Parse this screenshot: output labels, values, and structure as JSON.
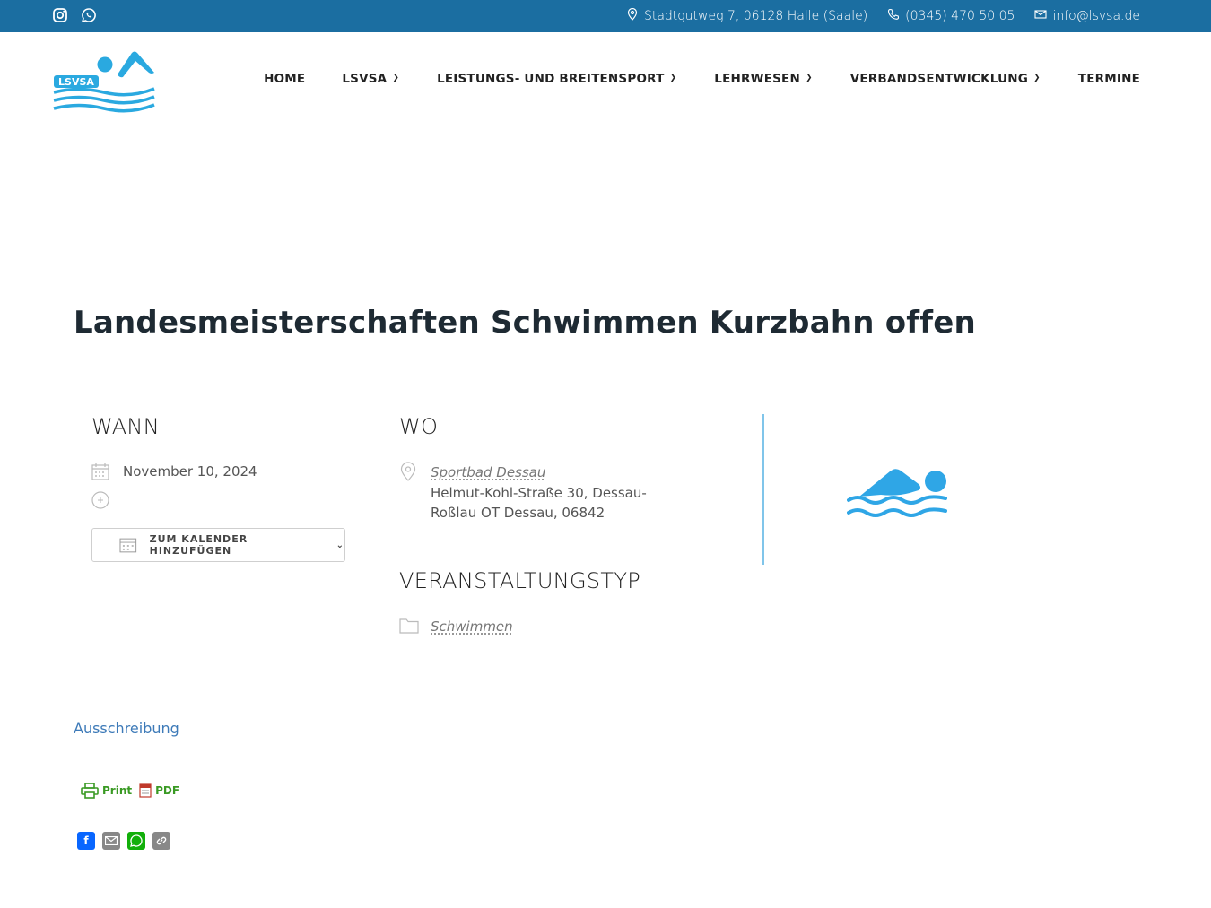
{
  "topbar": {
    "address": "Stadtgutweg 7, 06128 Halle (Saale)",
    "phone": "(0345) 470 50 05",
    "email": "info@lsvsa.de",
    "background": "#1b6ea1"
  },
  "logo": {
    "text": "LSVSA"
  },
  "nav": {
    "home": "HOME",
    "lsvsa": "LSVSA",
    "sport": "LEISTUNGS- UND BREITENSPORT",
    "lehrwesen": "LEHRWESEN",
    "verband": "VERBANDSENTWICKLUNG",
    "termine": "TERMINE"
  },
  "event": {
    "title": "Landesmeisterschaften Schwimmen Kurzbahn offen",
    "when_heading": "WANN",
    "date": "November 10, 2024",
    "add_calendar": "ZUM KALENDER HINZUFÜGEN",
    "where_heading": "WO",
    "venue": "Sportbad Dessau",
    "address_line1": "Helmut-Kohl-Straße 30, Dessau-",
    "address_line2": "Roßlau OT Dessau, 06842",
    "type_heading": "VERANSTALTUNGSTYP",
    "type": "Schwimmen",
    "accent": "#80c5ea"
  },
  "links": {
    "ausschreibung": "Ausschreibung",
    "print": "Print",
    "pdf": "PDF"
  },
  "share": {
    "facebook": "facebook-icon",
    "email": "email-icon",
    "whatsapp": "whatsapp-icon",
    "copy": "copy-link-icon"
  }
}
